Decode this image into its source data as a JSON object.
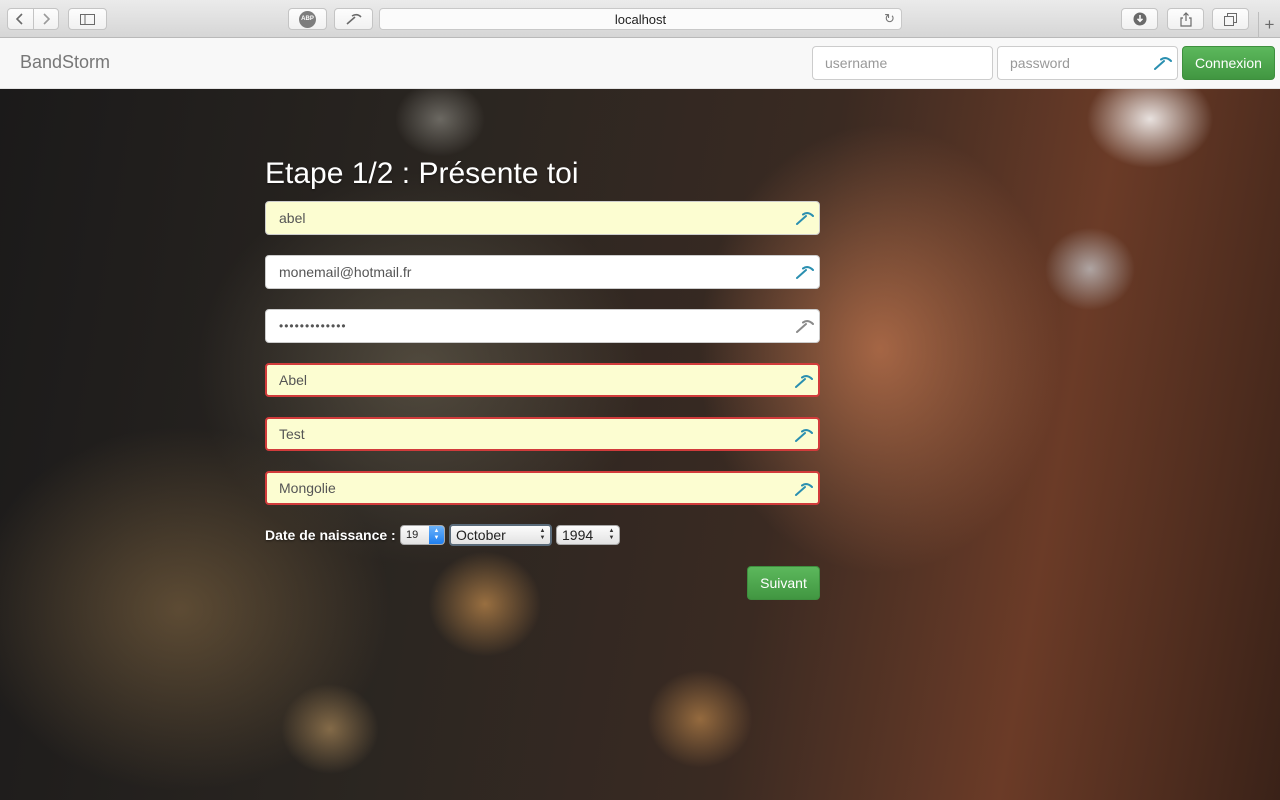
{
  "browser": {
    "url": "localhost",
    "abp_label": "ABP"
  },
  "navbar": {
    "brand": "BandStorm",
    "username_placeholder": "username",
    "password_placeholder": "password",
    "login_button": "Connexion"
  },
  "form": {
    "title": "Etape 1/2 : Présente toi",
    "fields": {
      "pseudo": "abel",
      "email": "monemail@hotmail.fr",
      "password_mask": "•••••••••••••",
      "prenom": "Abel",
      "nom": "Test",
      "pays": "Mongolie"
    },
    "birth": {
      "label": "Date de naissance :",
      "day": "19",
      "month": "October",
      "year": "1994"
    },
    "next_button": "Suivant"
  },
  "colors": {
    "success": "#5cb85c",
    "error_border": "#d13b3b",
    "autofill": "#fcfdd1",
    "key_icon": "#2a8fb0"
  }
}
